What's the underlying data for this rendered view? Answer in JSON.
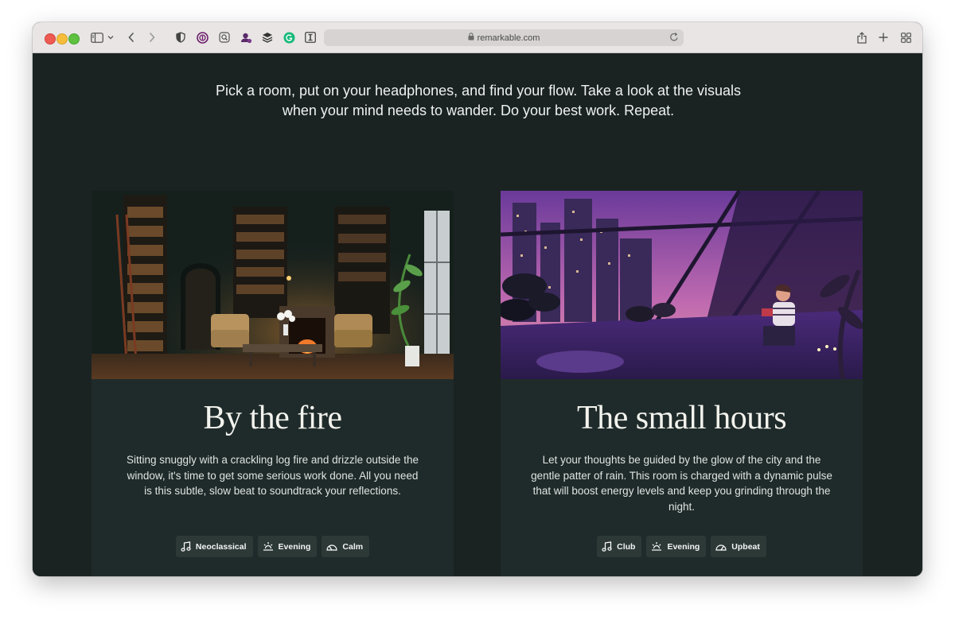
{
  "browser": {
    "url": "remarkable.com"
  },
  "intro": {
    "line1": "Pick a room, put on your headphones, and find your flow. Take a look at the visuals",
    "line2": "when your mind needs to wander. Do your best work. Repeat."
  },
  "cards": [
    {
      "title": "By the fire",
      "description": "Sitting snuggly with a crackling log fire and drizzle outside the window, it's time to get some serious work done. All you need is this subtle, slow beat to soundtrack your reflections.",
      "tags": [
        {
          "label": "Neoclassical",
          "icon": "music-note-icon"
        },
        {
          "label": "Evening",
          "icon": "sunset-icon"
        },
        {
          "label": "Calm",
          "icon": "gauge-icon"
        }
      ]
    },
    {
      "title": "The small hours",
      "description": "Let your thoughts be guided by the glow of the city and the gentle patter of rain. This room is charged with a dynamic pulse that will boost energy levels and keep you grinding through the night.",
      "tags": [
        {
          "label": "Club",
          "icon": "music-note-icon"
        },
        {
          "label": "Evening",
          "icon": "sunset-icon"
        },
        {
          "label": "Upbeat",
          "icon": "gauge-icon"
        }
      ]
    }
  ],
  "colors": {
    "page_background": "#1a2322",
    "card_background": "#1f2b2a",
    "tag_background": "#2c3937"
  }
}
